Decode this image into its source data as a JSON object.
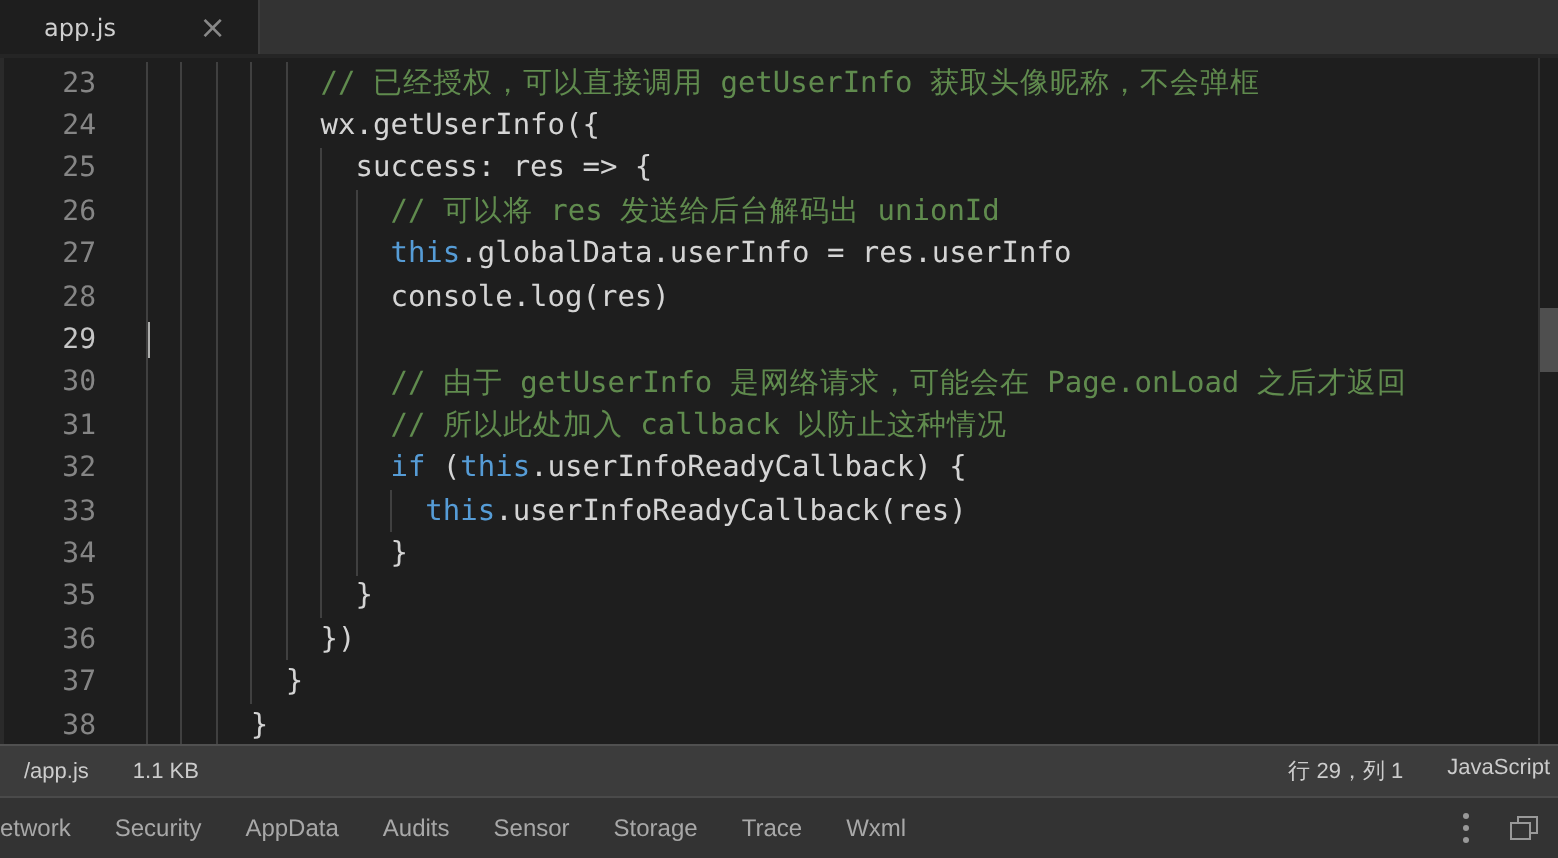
{
  "tabs": [
    {
      "label": "app.js",
      "close": "×",
      "selected": true
    }
  ],
  "editor": {
    "lines": [
      {
        "number": "23",
        "segments": [
          {
            "kind": "comment",
            "text": "          // 已经授权，可以直接调用 getUserInfo 获取头像昵称，不会弹框"
          }
        ]
      },
      {
        "number": "24",
        "segments": [
          {
            "kind": "plain",
            "text": "          wx.getUserInfo({"
          }
        ]
      },
      {
        "number": "25",
        "segments": [
          {
            "kind": "plain",
            "text": "            success: res => {"
          }
        ]
      },
      {
        "number": "26",
        "segments": [
          {
            "kind": "comment",
            "text": "              // 可以将 res 发送给后台解码出 unionId"
          }
        ]
      },
      {
        "number": "27",
        "segments": [
          {
            "kind": "keyword",
            "text": "              this"
          },
          {
            "kind": "plain",
            "text": ".globalData.userInfo = res.userInfo"
          }
        ]
      },
      {
        "number": "28",
        "segments": [
          {
            "kind": "plain",
            "text": "              console.log(res)"
          }
        ]
      },
      {
        "number": "29",
        "cursor": true
      },
      {
        "number": "30",
        "segments": [
          {
            "kind": "comment",
            "text": "              // 由于 getUserInfo 是网络请求，可能会在 Page.onLoad 之后才返回"
          }
        ]
      },
      {
        "number": "31",
        "segments": [
          {
            "kind": "comment",
            "text": "              // 所以此处加入 callback 以防止这种情况"
          }
        ]
      },
      {
        "number": "32",
        "segments": [
          {
            "kind": "keyword",
            "text": "              if"
          },
          {
            "kind": "plain",
            "text": " ("
          },
          {
            "kind": "keyword",
            "text": "this"
          },
          {
            "kind": "plain",
            "text": ".userInfoReadyCallback) {"
          }
        ]
      },
      {
        "number": "33",
        "segments": [
          {
            "kind": "keyword",
            "text": "                this"
          },
          {
            "kind": "plain",
            "text": ".userInfoReadyCallback(res)"
          }
        ]
      },
      {
        "number": "34",
        "segments": [
          {
            "kind": "plain",
            "text": "              }"
          }
        ]
      },
      {
        "number": "35",
        "segments": [
          {
            "kind": "plain",
            "text": "            }"
          }
        ]
      },
      {
        "number": "36",
        "segments": [
          {
            "kind": "plain",
            "text": "          })"
          }
        ]
      },
      {
        "number": "37",
        "segments": [
          {
            "kind": "plain",
            "text": "        }"
          }
        ]
      },
      {
        "number": "38",
        "segments": [
          {
            "kind": "plain",
            "text": "      }"
          }
        ]
      }
    ]
  },
  "status_bar": {
    "path": "/app.js",
    "size": "1.1 KB",
    "position": "行 29，列 1",
    "language": "JavaScript"
  },
  "panel_tabs": [
    {
      "label": "etwork",
      "selected": false
    },
    {
      "label": "Security",
      "selected": false
    },
    {
      "label": "AppData",
      "selected": false
    },
    {
      "label": "Audits",
      "selected": false
    },
    {
      "label": "Sensor",
      "selected": false
    },
    {
      "label": "Storage",
      "selected": false
    },
    {
      "label": "Trace",
      "selected": false
    },
    {
      "label": "Wxml",
      "selected": false
    }
  ]
}
